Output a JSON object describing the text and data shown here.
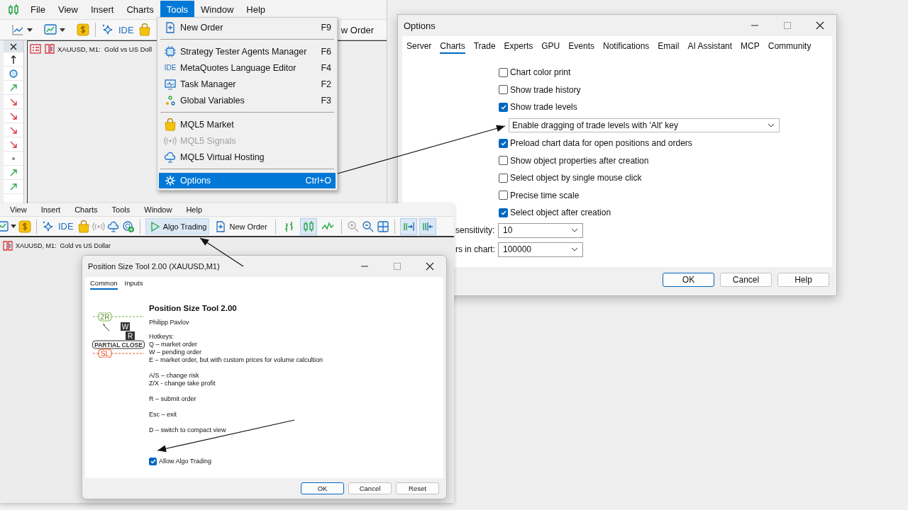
{
  "main_window": {
    "menu": [
      {
        "label": "File",
        "selected": false
      },
      {
        "label": "View",
        "selected": false
      },
      {
        "label": "Insert",
        "selected": false
      },
      {
        "label": "Charts",
        "selected": false
      },
      {
        "label": "Tools",
        "selected": true
      },
      {
        "label": "Window",
        "selected": false
      },
      {
        "label": "Help",
        "selected": false
      }
    ],
    "toolbar_ide": "IDE",
    "toolbar_fragment": "w Order",
    "chart_tab": "XAUUSD, M1:  Gold vs US Doll"
  },
  "tools_menu": {
    "items": [
      {
        "kind": "item",
        "label": "New Order",
        "shortcut": "F9",
        "disabled": false,
        "selected": false
      },
      {
        "kind": "separator"
      },
      {
        "kind": "item",
        "label": "Strategy Tester Agents Manager",
        "shortcut": "F6",
        "disabled": false,
        "selected": false
      },
      {
        "kind": "item",
        "icon_text": "IDE",
        "label": "MetaQuotes Language Editor",
        "shortcut": "F4",
        "disabled": false,
        "selected": false
      },
      {
        "kind": "item",
        "label": "Task Manager",
        "shortcut": "F2",
        "disabled": false,
        "selected": false
      },
      {
        "kind": "item",
        "label": "Global Variables",
        "shortcut": "F3",
        "disabled": false,
        "selected": false
      },
      {
        "kind": "separator"
      },
      {
        "kind": "item",
        "label": "MQL5 Market",
        "disabled": false,
        "selected": false
      },
      {
        "kind": "item",
        "label": "MQL5 Signals",
        "disabled": true,
        "selected": false
      },
      {
        "kind": "item",
        "label": "MQL5 Virtual Hosting",
        "disabled": false,
        "selected": false
      },
      {
        "kind": "separator"
      },
      {
        "kind": "item",
        "label": "Options",
        "shortcut": "Ctrl+O",
        "disabled": false,
        "selected": true
      }
    ]
  },
  "options_dialog": {
    "title": "Options",
    "tabs": [
      {
        "label": "Server",
        "selected": false
      },
      {
        "label": "Charts",
        "selected": true
      },
      {
        "label": "Trade",
        "selected": false
      },
      {
        "label": "Experts",
        "selected": false
      },
      {
        "label": "GPU",
        "selected": false
      },
      {
        "label": "Events",
        "selected": false
      },
      {
        "label": "Notifications",
        "selected": false
      },
      {
        "label": "Email",
        "selected": false
      },
      {
        "label": "AI Assistant",
        "selected": false
      },
      {
        "label": "MCP",
        "selected": false
      },
      {
        "label": "Community",
        "selected": false
      }
    ],
    "settings": [
      {
        "kind": "checkbox",
        "label": "Chart color print",
        "checked": false
      },
      {
        "kind": "checkbox",
        "label": "Show trade history",
        "checked": false
      },
      {
        "kind": "checkbox",
        "label": "Show trade levels",
        "checked": true
      },
      {
        "kind": "select",
        "value": "Enable dragging of trade levels with 'Alt' key"
      },
      {
        "kind": "checkbox",
        "label": "Preload chart data for open positions and orders",
        "checked": true
      },
      {
        "kind": "checkbox",
        "label": "Show object properties after creation",
        "checked": false
      },
      {
        "kind": "checkbox",
        "label": "Select object by single mouse click",
        "checked": false
      },
      {
        "kind": "checkbox",
        "label": "Precise time scale",
        "checked": false
      },
      {
        "kind": "checkbox",
        "label": "Select object after creation",
        "checked": true
      }
    ],
    "fields": [
      {
        "label": "sensitivity:",
        "value": "10"
      },
      {
        "label": "rs in chart:",
        "value": "100000"
      }
    ],
    "buttons": [
      {
        "label": "OK",
        "default": true
      },
      {
        "label": "Cancel",
        "default": false
      },
      {
        "label": "Help",
        "default": false
      }
    ]
  },
  "second_window": {
    "menu": [
      "View",
      "Insert",
      "Charts",
      "Tools",
      "Window",
      "Help"
    ],
    "toolbar_ide": "IDE",
    "algo_trading": {
      "label": "Algo Trading",
      "on": true
    },
    "new_order": "New Order",
    "chart_modes": [
      {
        "selected": false
      },
      {
        "selected": true
      },
      {
        "selected": false
      }
    ],
    "scroll_toggles": [
      {
        "on": true
      },
      {
        "on": true
      }
    ],
    "chart_tab": "XAUUSD, M1:  Gold vs US Dollar"
  },
  "position_dialog": {
    "title": "Position Size Tool 2.00 (XAUUSD,M1)",
    "tabs": [
      {
        "label": "Common",
        "selected": true
      },
      {
        "label": "Inputs",
        "selected": false
      }
    ],
    "logo": {
      "top_tag": "2R",
      "keys": [
        "W",
        "R"
      ],
      "banner": "PARTIAL CLOSE",
      "bottom_tag": "SL"
    },
    "heading": "Position Size Tool 2.00",
    "author": "Philipp Pavlov",
    "hotkey_groups": [
      [
        "Hotkeys:",
        "Q – market order",
        "W – pending order",
        "E – market order, but with custom prices for volume calcultion"
      ],
      [
        "A/S – change risk",
        "Z/X - change take profit"
      ],
      [
        "R – submit order"
      ],
      [
        "Esc – exit"
      ],
      [
        "D – switch to compact view"
      ]
    ],
    "allow_algo": {
      "label": "Allow Algo Trading",
      "checked": true
    },
    "buttons": [
      {
        "label": "OK",
        "default": true
      },
      {
        "label": "Cancel",
        "default": false
      },
      {
        "label": "Reset",
        "default": false
      }
    ]
  }
}
